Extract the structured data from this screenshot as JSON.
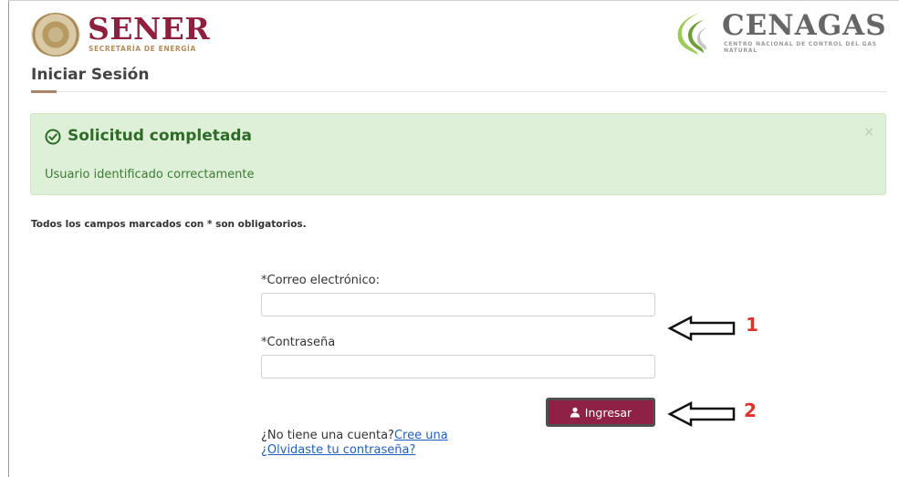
{
  "header": {
    "sener_logo_text": "SENER",
    "sener_subtitle": "SECRETARÍA DE ENERGÍA",
    "cenagas_logo_text": "CENAGAS",
    "cenagas_subtitle": "CENTRO NACIONAL DE CONTROL DEL GAS NATURAL"
  },
  "page": {
    "title": "Iniciar Sesión"
  },
  "alert": {
    "title": "Solicitud completada",
    "message": "Usuario identificado correctamente",
    "close_label": "×",
    "icon": "check-circle-icon",
    "background": "#dff0d8",
    "text_color": "#2e6b28"
  },
  "form": {
    "required_note": "Todos los campos marcados con * son obligatorios.",
    "email_label": "*Correo electrónico:",
    "email_value": "",
    "password_label": "*Contraseña",
    "password_value": "",
    "login_button": "Ingresar",
    "login_icon": "user-icon",
    "no_account_text": "¿No tiene una cuenta?",
    "create_link": "Cree una",
    "forgot_link": "¿Olvidaste tu contraseña?"
  },
  "annotations": {
    "label_1": "1",
    "label_2": "2",
    "color": "#e0322c"
  },
  "colors": {
    "brand": "#8f2146",
    "accent": "#a78566",
    "link": "#1f5fbf"
  }
}
